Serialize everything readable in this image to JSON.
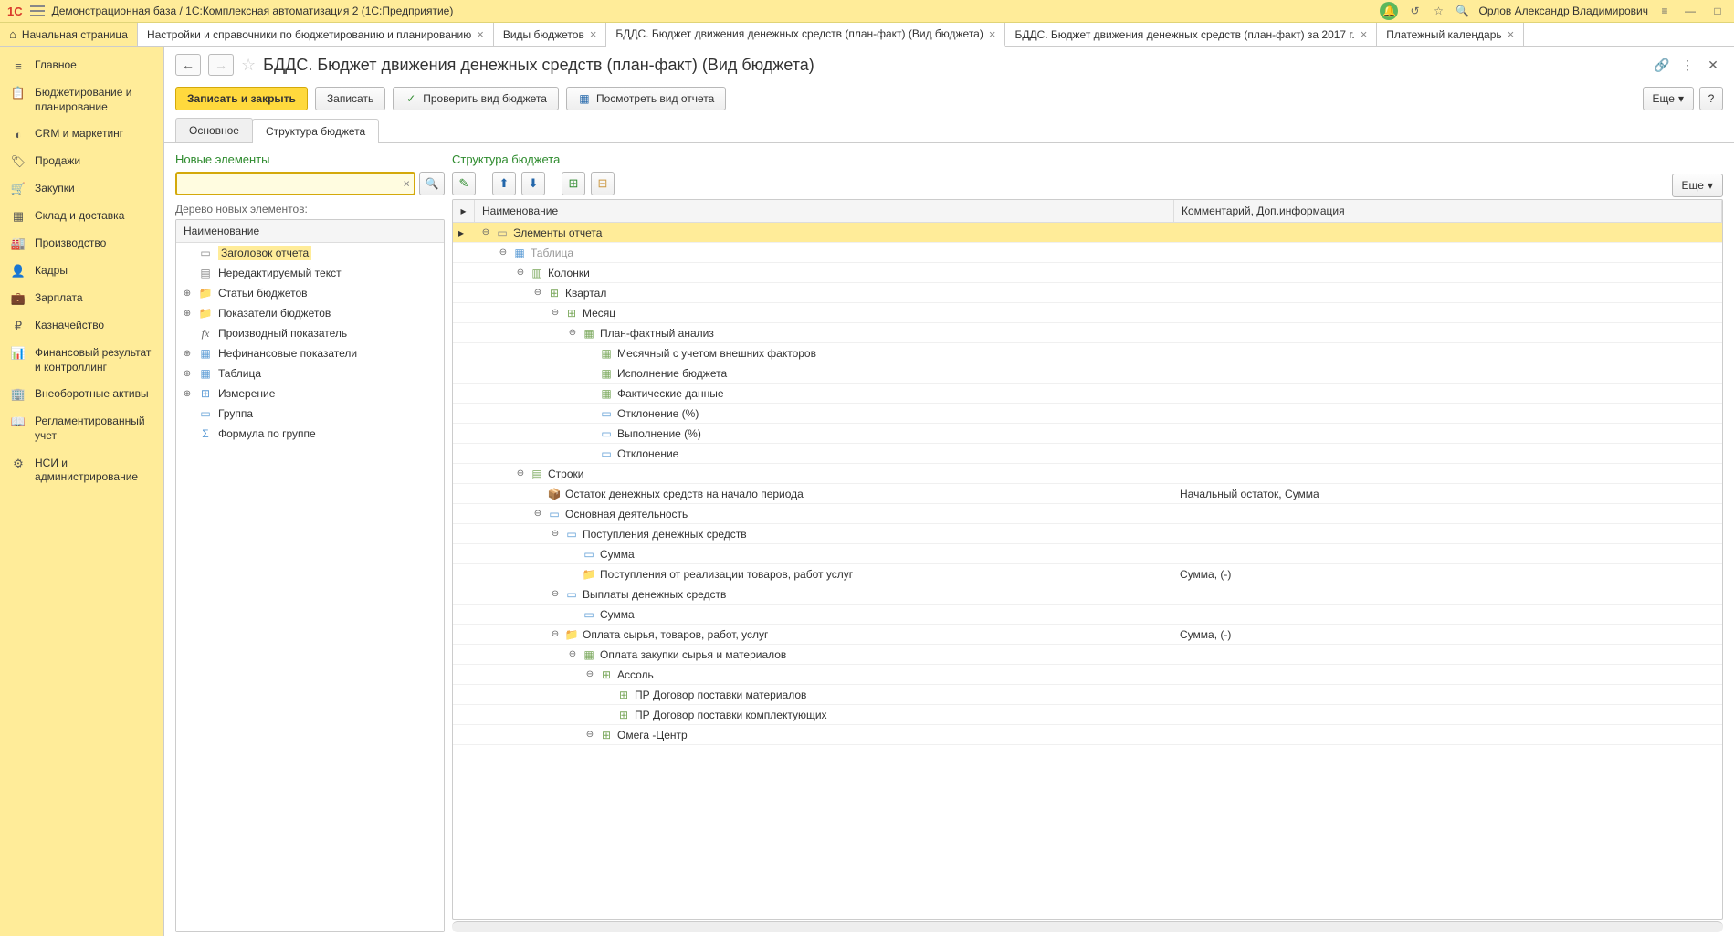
{
  "titlebar": {
    "logo": "1С",
    "title": "Демонстрационная база / 1С:Комплексная автоматизация 2  (1С:Предприятие)",
    "user": "Орлов Александр Владимирович"
  },
  "tabs": [
    {
      "label": "Начальная страница",
      "home": true,
      "closable": false
    },
    {
      "label": "Настройки и справочники по бюджетированию и планированию",
      "closable": true
    },
    {
      "label": "Виды  бюджетов",
      "closable": true
    },
    {
      "label": "БДДС. Бюджет движения денежных средств (план-факт) (Вид бюджета)",
      "closable": true,
      "active": true
    },
    {
      "label": "БДДС. Бюджет движения денежных средств (план-факт)  за 2017 г.",
      "closable": true
    },
    {
      "label": "Платежный календарь",
      "closable": true
    }
  ],
  "leftnav": [
    {
      "icon": "≡",
      "label": "Главное"
    },
    {
      "icon": "📋",
      "label": "Бюджетирование и планирование"
    },
    {
      "icon": "◐",
      "label": "CRM и маркетинг"
    },
    {
      "icon": "🏷",
      "label": "Продажи"
    },
    {
      "icon": "🛒",
      "label": "Закупки"
    },
    {
      "icon": "▦",
      "label": "Склад и доставка"
    },
    {
      "icon": "🏭",
      "label": "Производство"
    },
    {
      "icon": "👤",
      "label": "Кадры"
    },
    {
      "icon": "💼",
      "label": "Зарплата"
    },
    {
      "icon": "₽",
      "label": "Казначейство"
    },
    {
      "icon": "📊",
      "label": "Финансовый результат и контроллинг"
    },
    {
      "icon": "🏢",
      "label": "Внеоборотные активы"
    },
    {
      "icon": "📖",
      "label": "Регламентированный учет"
    },
    {
      "icon": "⚙",
      "label": "НСИ и администрирование"
    }
  ],
  "page": {
    "title": "БДДС. Бюджет движения денежных средств (план-факт) (Вид бюджета)"
  },
  "toolbar": {
    "save_close": "Записать и закрыть",
    "save": "Записать",
    "check": "Проверить вид бюджета",
    "view_report": "Посмотреть вид отчета",
    "more": "Еще"
  },
  "inner_tabs": [
    {
      "label": "Основное"
    },
    {
      "label": "Структура бюджета",
      "active": true
    }
  ],
  "left_panel": {
    "title": "Новые элементы",
    "tree_label": "Дерево новых элементов:",
    "header": "Наименование",
    "items": [
      {
        "icon": "▭",
        "iconClass": "ic-header",
        "label": "Заголовок отчета",
        "selected": true
      },
      {
        "icon": "▤",
        "iconClass": "ic-text",
        "label": "Нередактируемый текст"
      },
      {
        "icon": "📁",
        "iconClass": "ic-folder",
        "label": "Статьи бюджетов",
        "expandable": true
      },
      {
        "icon": "📁",
        "iconClass": "ic-folder",
        "label": "Показатели бюджетов",
        "expandable": true
      },
      {
        "icon": "fx",
        "iconClass": "ic-fx",
        "label": "Производный показатель"
      },
      {
        "icon": "▦",
        "iconClass": "ic-table",
        "label": "Нефинансовые показатели",
        "expandable": true
      },
      {
        "icon": "▦",
        "iconClass": "ic-table",
        "label": "Таблица",
        "expandable": true
      },
      {
        "icon": "⊞",
        "iconClass": "ic-dim",
        "label": "Измерение",
        "expandable": true
      },
      {
        "icon": "▭",
        "iconClass": "ic-group",
        "label": "Группа"
      },
      {
        "icon": "Σ",
        "iconClass": "ic-group",
        "label": "Формула по группе"
      }
    ]
  },
  "right_panel": {
    "title": "Структура бюджета",
    "more": "Еще",
    "header_name": "Наименование",
    "header_comment": "Комментарий, Доп.информация",
    "rows": [
      {
        "depth": 0,
        "exp": "⊖",
        "icon": "▭",
        "iconClass": "ic-header",
        "label": "Элементы отчета",
        "selected": true
      },
      {
        "depth": 1,
        "exp": "⊖",
        "icon": "▦",
        "iconClass": "ic-table",
        "label": "Таблица",
        "dim": true
      },
      {
        "depth": 2,
        "exp": "⊖",
        "icon": "▥",
        "iconClass": "ic-col",
        "label": "Колонки"
      },
      {
        "depth": 3,
        "exp": "⊖",
        "icon": "⊞",
        "iconClass": "ic-grid",
        "label": "Квартал"
      },
      {
        "depth": 4,
        "exp": "⊖",
        "icon": "⊞",
        "iconClass": "ic-grid",
        "label": "Месяц"
      },
      {
        "depth": 5,
        "exp": "⊖",
        "icon": "▦",
        "iconClass": "ic-grid",
        "label": "План-фактный анализ"
      },
      {
        "depth": 6,
        "exp": "",
        "icon": "▦",
        "iconClass": "ic-grid",
        "label": "Месячный с учетом внешних факторов"
      },
      {
        "depth": 6,
        "exp": "",
        "icon": "▦",
        "iconClass": "ic-grid",
        "label": "Исполнение бюджета"
      },
      {
        "depth": 6,
        "exp": "",
        "icon": "▦",
        "iconClass": "ic-grid",
        "label": "Фактические данные"
      },
      {
        "depth": 6,
        "exp": "",
        "icon": "▭",
        "iconClass": "ic-cell",
        "label": "Отклонение (%)"
      },
      {
        "depth": 6,
        "exp": "",
        "icon": "▭",
        "iconClass": "ic-cell",
        "label": "Выполнение (%)"
      },
      {
        "depth": 6,
        "exp": "",
        "icon": "▭",
        "iconClass": "ic-cell",
        "label": "Отклонение"
      },
      {
        "depth": 2,
        "exp": "⊖",
        "icon": "▤",
        "iconClass": "ic-col",
        "label": "Строки"
      },
      {
        "depth": 3,
        "exp": "",
        "icon": "📦",
        "iconClass": "ic-box",
        "label": "Остаток денежных средств на начало периода",
        "comment": "Начальный остаток, Сумма"
      },
      {
        "depth": 3,
        "exp": "⊖",
        "icon": "▭",
        "iconClass": "ic-group",
        "label": "Основная деятельность"
      },
      {
        "depth": 4,
        "exp": "⊖",
        "icon": "▭",
        "iconClass": "ic-group",
        "label": "Поступления денежных средств"
      },
      {
        "depth": 5,
        "exp": "",
        "icon": "▭",
        "iconClass": "ic-cell",
        "label": "Сумма"
      },
      {
        "depth": 5,
        "exp": "",
        "icon": "📁",
        "iconClass": "ic-folder",
        "label": "Поступления от реализации товаров, работ услуг",
        "comment": "Сумма, (-)"
      },
      {
        "depth": 4,
        "exp": "⊖",
        "icon": "▭",
        "iconClass": "ic-group",
        "label": "Выплаты денежных средств"
      },
      {
        "depth": 5,
        "exp": "",
        "icon": "▭",
        "iconClass": "ic-cell",
        "label": "Сумма"
      },
      {
        "depth": 4,
        "exp": "⊖",
        "icon": "📁",
        "iconClass": "ic-folder",
        "label": "Оплата сырья, товаров, работ, услуг",
        "comment": "Сумма, (-)"
      },
      {
        "depth": 5,
        "exp": "⊖",
        "icon": "▦",
        "iconClass": "ic-grid",
        "label": "Оплата закупки сырья и материалов"
      },
      {
        "depth": 6,
        "exp": "⊖",
        "icon": "⊞",
        "iconClass": "ic-grid",
        "label": "Ассоль"
      },
      {
        "depth": 7,
        "exp": "",
        "icon": "⊞",
        "iconClass": "ic-grid",
        "label": "ПР Договор поставки материалов"
      },
      {
        "depth": 7,
        "exp": "",
        "icon": "⊞",
        "iconClass": "ic-grid",
        "label": "ПР Договор поставки комплектующих"
      },
      {
        "depth": 6,
        "exp": "⊖",
        "icon": "⊞",
        "iconClass": "ic-grid",
        "label": "Омега -Центр"
      }
    ]
  }
}
